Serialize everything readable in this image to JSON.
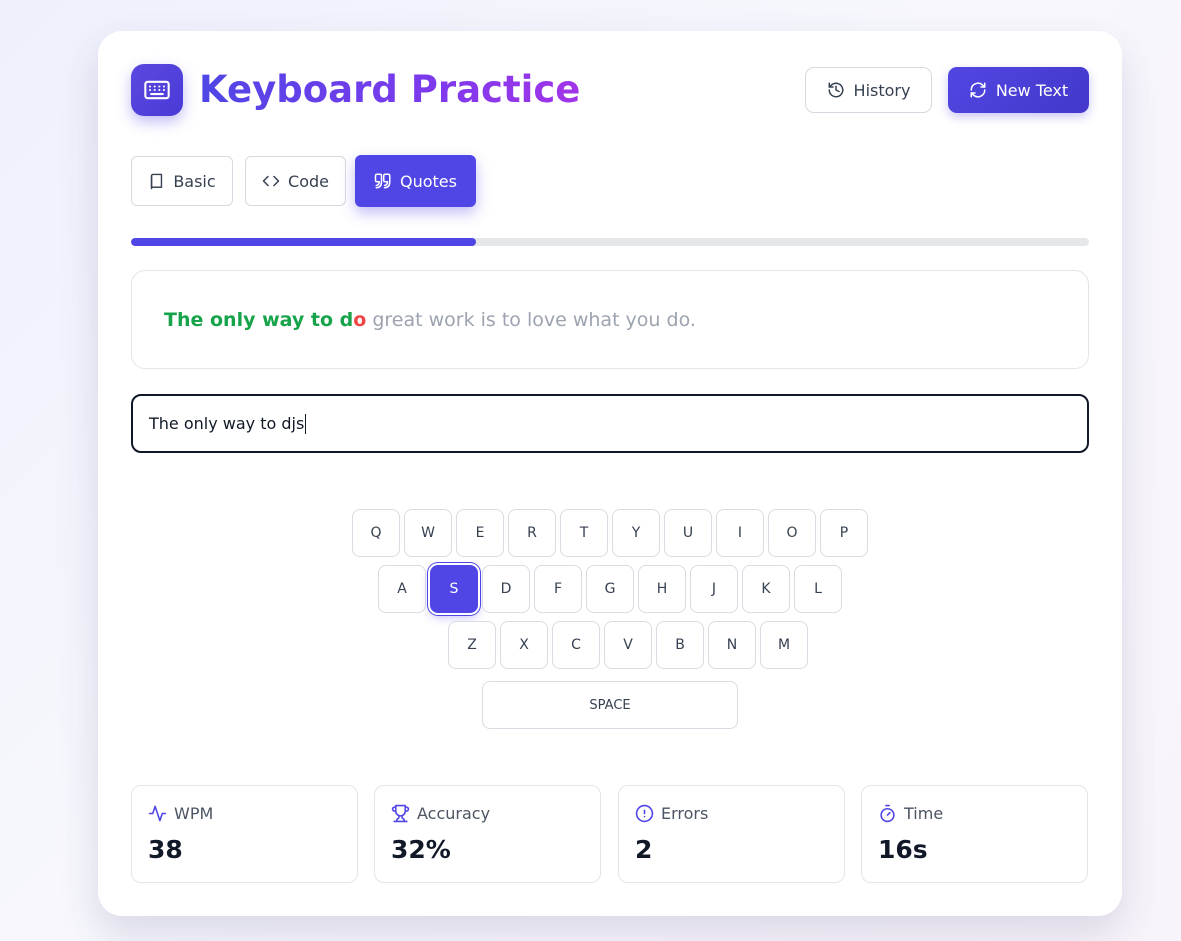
{
  "header": {
    "title": "Keyboard Practice",
    "history_label": "History",
    "new_text_label": "New Text"
  },
  "modes": [
    {
      "label": "Basic",
      "icon": "book-icon",
      "active": false
    },
    {
      "label": "Code",
      "icon": "code-icon",
      "active": false
    },
    {
      "label": "Quotes",
      "icon": "quote-icon",
      "active": true
    }
  ],
  "progress": {
    "fraction": 0.36
  },
  "target_text": {
    "correct": "The only way to d",
    "error": "o",
    "pending": " great work is to love what you do."
  },
  "input": {
    "value": "The only way to djs"
  },
  "keyboard": {
    "row1": [
      "Q",
      "W",
      "E",
      "R",
      "T",
      "Y",
      "U",
      "I",
      "O",
      "P"
    ],
    "row2": [
      "A",
      "S",
      "D",
      "F",
      "G",
      "H",
      "J",
      "K",
      "L"
    ],
    "row3": [
      "Z",
      "X",
      "C",
      "V",
      "B",
      "N",
      "M"
    ],
    "space_label": "SPACE",
    "pressed_key": "S"
  },
  "stats": [
    {
      "label": "WPM",
      "value": "38",
      "icon": "activity-icon"
    },
    {
      "label": "Accuracy",
      "value": "32%",
      "icon": "trophy-icon"
    },
    {
      "label": "Errors",
      "value": "2",
      "icon": "alert-circle-icon"
    },
    {
      "label": "Time",
      "value": "16s",
      "icon": "timer-icon"
    }
  ],
  "colors": {
    "accent": "#4f46e5",
    "correct": "#16a34a",
    "error": "#ef4444",
    "pending": "#9ca3af"
  }
}
